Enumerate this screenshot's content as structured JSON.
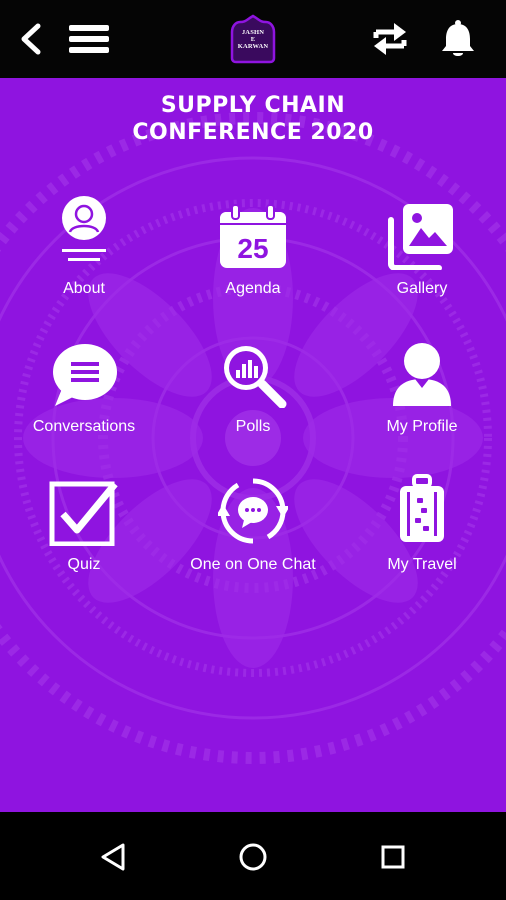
{
  "app": {
    "logo_text_line1": "JASHN",
    "logo_text_line2": "E",
    "logo_text_line3": "KARWAN"
  },
  "topbar": {
    "icons": [
      "back-arrow-icon",
      "hamburger-menu-icon",
      "sync-icon",
      "bell-icon"
    ]
  },
  "header": {
    "title_line1": "SUPPLY CHAIN",
    "title_line2": "CONFERENCE 2020"
  },
  "tiles": [
    {
      "label": "About",
      "icon": "about-icon"
    },
    {
      "label": "Agenda",
      "icon": "calendar-icon",
      "calendar_day": "25"
    },
    {
      "label": "Gallery",
      "icon": "gallery-icon"
    },
    {
      "label": "Conversations",
      "icon": "chat-bubble-icon"
    },
    {
      "label": "Polls",
      "icon": "polls-icon"
    },
    {
      "label": "My Profile",
      "icon": "profile-icon"
    },
    {
      "label": "Quiz",
      "icon": "checkbox-icon"
    },
    {
      "label": "One on One Chat",
      "icon": "one-on-one-chat-icon"
    },
    {
      "label": "My Travel",
      "icon": "luggage-icon"
    }
  ],
  "colors": {
    "background": "#8f14e0",
    "bars": "#050505",
    "icon": "#ffffff"
  },
  "navbar": {
    "icons": [
      "nav-back-icon",
      "nav-home-icon",
      "nav-recents-icon"
    ]
  }
}
